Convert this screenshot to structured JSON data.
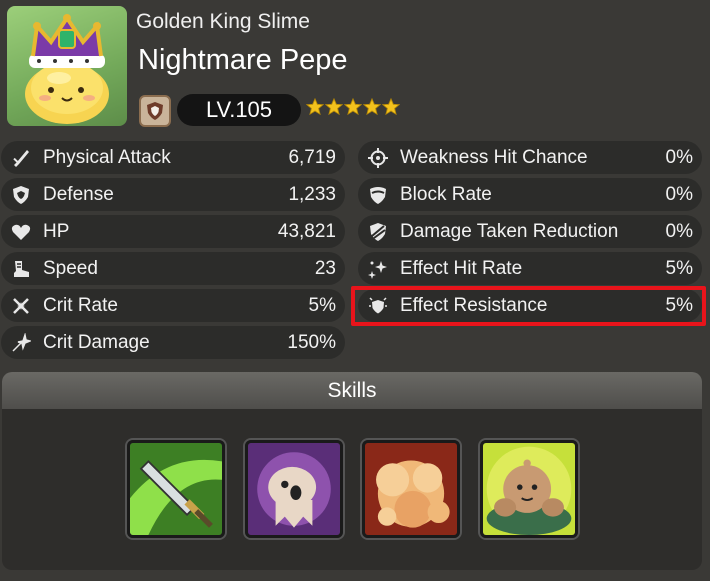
{
  "unit": {
    "species": "Golden King Slime",
    "name": "Nightmare Pepe",
    "level": "LV.105",
    "stars": 5,
    "portrait": "golden-king-slime-portrait",
    "rank_icon": "shield-rank-icon"
  },
  "stats_left": [
    {
      "icon": "sword-icon",
      "label": "Physical Attack",
      "value": "6,719"
    },
    {
      "icon": "shield-icon",
      "label": "Defense",
      "value": "1,233"
    },
    {
      "icon": "heart-icon",
      "label": "HP",
      "value": "43,821"
    },
    {
      "icon": "boot-icon",
      "label": "Speed",
      "value": "23"
    },
    {
      "icon": "crit-rate-icon",
      "label": "Crit Rate",
      "value": "5%"
    },
    {
      "icon": "crit-damage-icon",
      "label": "Crit Damage",
      "value": "150%"
    }
  ],
  "stats_right": [
    {
      "icon": "crosshair-icon",
      "label": "Weakness Hit Chance",
      "value": "0%"
    },
    {
      "icon": "block-icon",
      "label": "Block Rate",
      "value": "0%"
    },
    {
      "icon": "damage-reduction-icon",
      "label": "Damage Taken Reduction",
      "value": "0%"
    },
    {
      "icon": "effect-hit-icon",
      "label": "Effect Hit Rate",
      "value": "5%"
    },
    {
      "icon": "effect-resistance-icon",
      "label": "Effect Resistance",
      "value": "5%"
    }
  ],
  "highlighted_stat": "Effect Resistance",
  "highlight_color": "#e8141b",
  "skills": {
    "title": "Skills",
    "items": [
      "dagger-skill-icon",
      "ghost-skill-icon",
      "explosion-skill-icon",
      "golem-skill-icon"
    ]
  },
  "colors": {
    "background": "#3a3936",
    "row": "#2c2c2a",
    "star": "#f3c21d",
    "level_pill": "#141414"
  }
}
